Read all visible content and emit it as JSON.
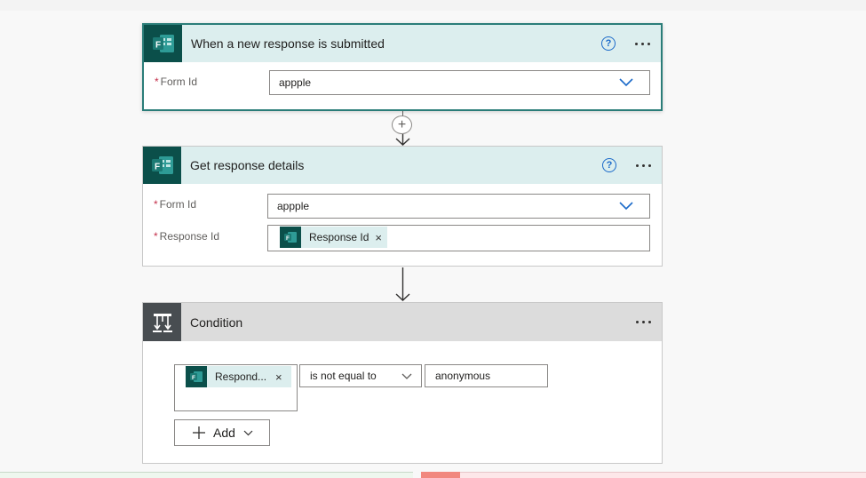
{
  "trigger": {
    "title": "When a new response is submitted",
    "help_icon": "question-circle-icon",
    "more_icon": "ellipsis-icon",
    "form_id_label": "Form Id",
    "form_id_value": "appple"
  },
  "connector": {
    "plus_symbol": "+"
  },
  "get_details": {
    "title": "Get response details",
    "form_id_label": "Form Id",
    "form_id_value": "appple",
    "response_id_label": "Response Id",
    "response_id_token": "Response Id",
    "token_close": "×"
  },
  "condition": {
    "title": "Condition",
    "left_token": "Respond...",
    "token_close": "×",
    "operator": "is not equal to",
    "right_value": "anonymous",
    "add_label": "Add"
  },
  "colors": {
    "forms_brand": "#0b4f4a",
    "header_teal": "#dceeee",
    "condition_header": "#dcdcdc",
    "link_blue": "#1b6ac9",
    "yes_branch": "#eef7ee",
    "no_branch": "#fde7e9",
    "no_branch_accent": "#f1887f"
  }
}
